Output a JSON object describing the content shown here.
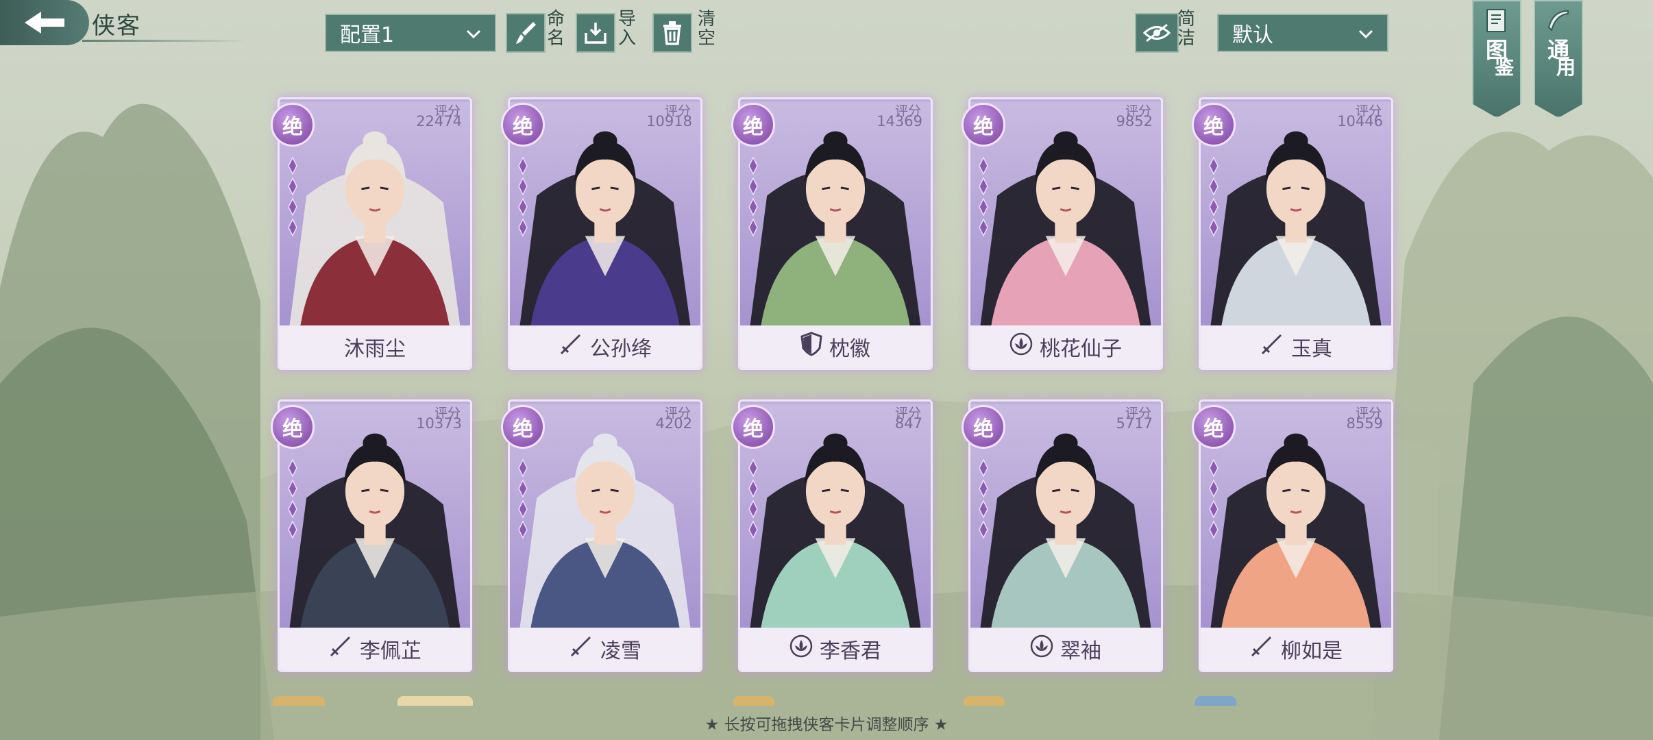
{
  "header": {
    "title": "侠客",
    "config_select": "配置1",
    "rename_label": "命名",
    "import_label": "导入",
    "clear_label": "清空",
    "simple_label": "简洁",
    "sort_select": "默认"
  },
  "side_tabs": [
    {
      "label_a": "图",
      "label_b": "鉴"
    },
    {
      "label_a": "通",
      "label_b": "用"
    }
  ],
  "cards": [
    {
      "name": "沐雨尘",
      "rank": "绝",
      "score_label": "评分",
      "score": "22474",
      "type_icon": "",
      "robe": "#8b2f3a",
      "hair": "#e8e4e0"
    },
    {
      "name": "公孙绛",
      "rank": "绝",
      "score_label": "评分",
      "score": "10918",
      "type_icon": "sword-icon",
      "robe": "#4b3b8c",
      "hair": "#1c1a22"
    },
    {
      "name": "枕徽",
      "rank": "绝",
      "score_label": "评分",
      "score": "14369",
      "type_icon": "shield-icon",
      "robe": "#8fb27c",
      "hair": "#1c1a22"
    },
    {
      "name": "桃花仙子",
      "rank": "绝",
      "score_label": "评分",
      "score": "9852",
      "type_icon": "lotus-icon",
      "robe": "#e6a3b8",
      "hair": "#1c1a22"
    },
    {
      "name": "玉真",
      "rank": "绝",
      "score_label": "评分",
      "score": "10446",
      "type_icon": "sword-icon",
      "robe": "#cfd6dd",
      "hair": "#1c1a22"
    },
    {
      "name": "李佩芷",
      "rank": "绝",
      "score_label": "评分",
      "score": "10373",
      "type_icon": "sword-icon",
      "robe": "#3a4356",
      "hair": "#1c1a22"
    },
    {
      "name": "凌雪",
      "rank": "绝",
      "score_label": "评分",
      "score": "4202",
      "type_icon": "sword-icon",
      "robe": "#4a5684",
      "hair": "#e4e4ec"
    },
    {
      "name": "李香君",
      "rank": "绝",
      "score_label": "评分",
      "score": "847",
      "type_icon": "lotus-icon",
      "robe": "#9fd0bd",
      "hair": "#1c1a22"
    },
    {
      "name": "翠袖",
      "rank": "绝",
      "score_label": "评分",
      "score": "5717",
      "type_icon": "lotus-icon",
      "robe": "#a7c6bf",
      "hair": "#1c1a22"
    },
    {
      "name": "柳如是",
      "rank": "绝",
      "score_label": "评分",
      "score": "8559",
      "type_icon": "sword-icon",
      "robe": "#f0a486",
      "hair": "#1c1a22"
    }
  ],
  "footer": {
    "hint": "★ 长按可拖拽侠客卡片调整顺序 ★"
  },
  "colors": {
    "accent": "#4f7a70",
    "card_purple": "#a895cf",
    "badge_purple": "#7a3f9f"
  }
}
